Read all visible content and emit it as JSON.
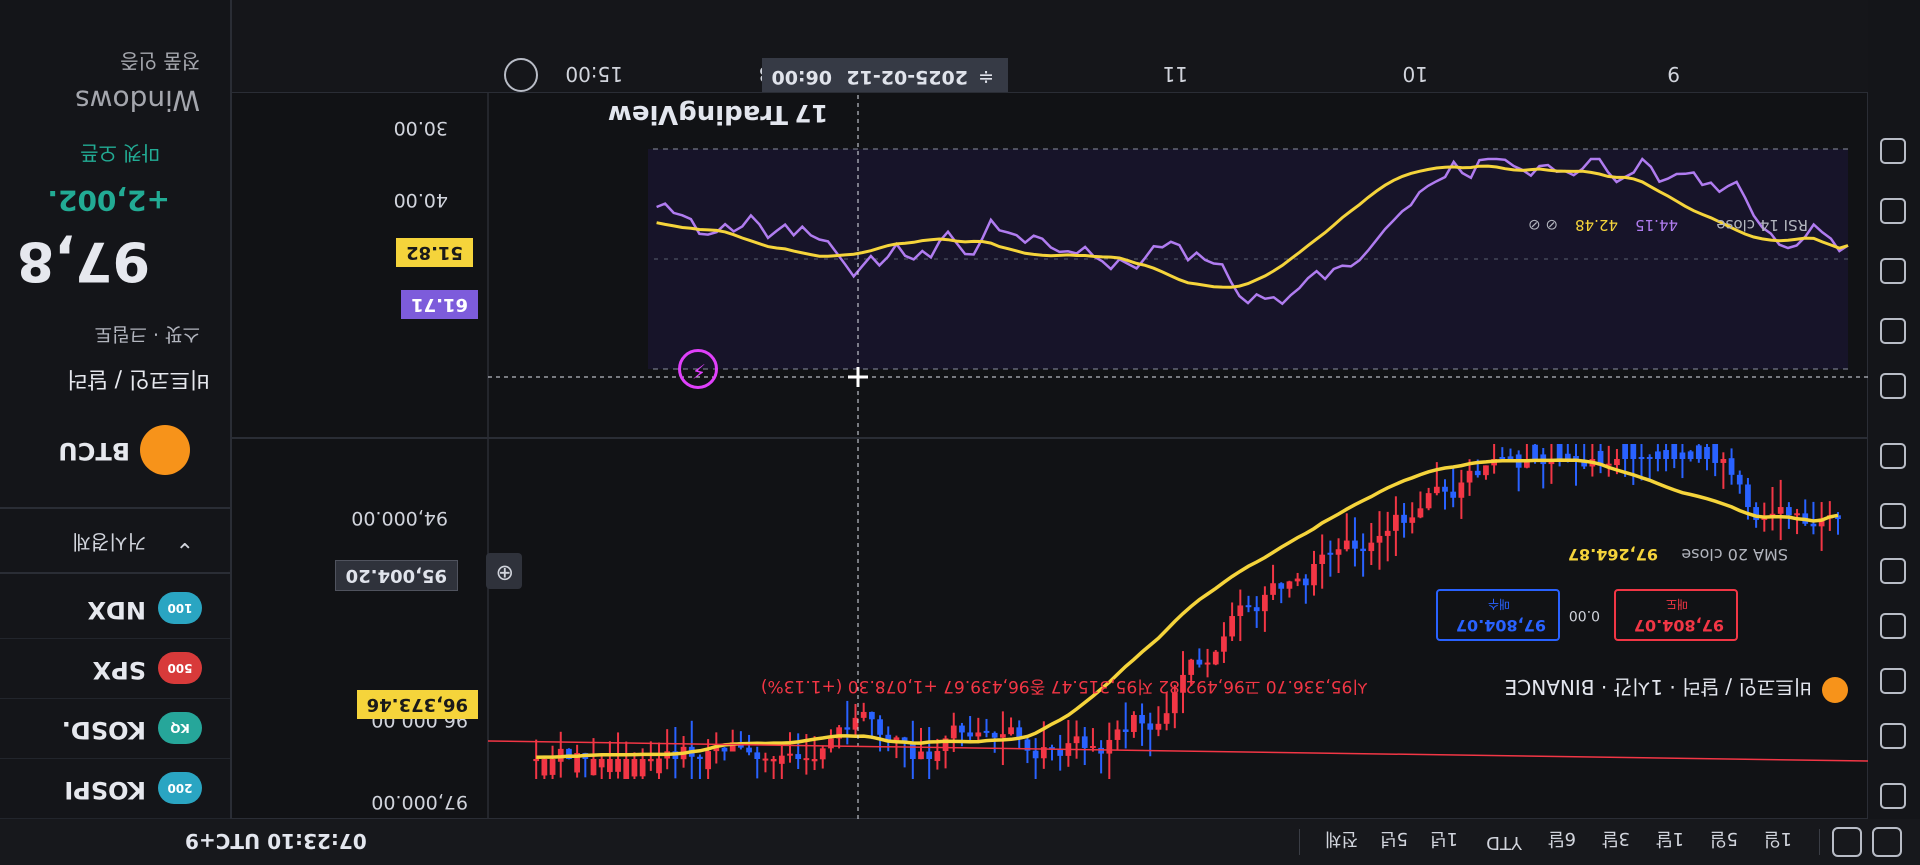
{
  "symbol_header": {
    "title": "비트코인 / 달러 · 1시간 · BINANCE",
    "ohlc": "시95,336.70 고96,492.82 저95,315.47 종96,439.67 +1,078.30 (+1.13%)",
    "sell_price": "97,804.07",
    "sell_label": "매도",
    "spread": "0.00",
    "buy_price": "97,804.07",
    "buy_label": "매수",
    "sma_label": "SMA 20 close",
    "sma_value": "97,264.87",
    "rsi_label": "RSI 14 close",
    "rsi_value": "44.15",
    "rsi_ma_value": "42.48"
  },
  "price_axis": {
    "ticks": [
      "97,000.00",
      "96,000.00",
      "94,000.00"
    ],
    "sma_tag": "96,373.46",
    "crosshair_price": "95,004.20"
  },
  "rsi_axis": {
    "ticks": [
      "40.00",
      "30.00"
    ],
    "rsi_tag": "61.71",
    "ma_tag": "51.82"
  },
  "time_axis": {
    "labels": [
      "9",
      "10",
      "11",
      "13",
      "15:00"
    ],
    "crosshair_date": "2025-02-12",
    "crosshair_time": "06:00"
  },
  "watermark": "TradingView",
  "timeframes": [
    "1일",
    "5일",
    "1달",
    "3달",
    "6달",
    "YTD",
    "1년",
    "5년",
    "전체"
  ],
  "clock": "07:23:10 UTC+9",
  "right_panel": {
    "os_hint": "Windows",
    "os_hint2": "정품 인증",
    "quote_title": "비트코인 / 달러",
    "quote_sub": "스팟 · 크립토",
    "market_status": "마켓 오픈",
    "price": "97,8",
    "change": "+2,002.",
    "section_title": "거시경제",
    "watchlist": [
      {
        "badge": "100",
        "symbol": "NDX",
        "color": "#2aa5c2"
      },
      {
        "badge": "500",
        "symbol": "SPX",
        "color": "#d83a3a"
      },
      {
        "badge": "KQ",
        "symbol": "KOSD.",
        "color": "#26a69a"
      },
      {
        "badge": "200",
        "symbol": "KOSPI",
        "color": "#2aa5c2"
      }
    ]
  },
  "colors": {
    "up": "#f23645",
    "down": "#2962ff",
    "sma": "#f5d43b",
    "rsi": "#b07cf0"
  },
  "chart_data": {
    "type": "candlestick",
    "series": [
      {
        "name": "SMA 20 close",
        "last": 97264.87
      },
      {
        "name": "RSI 14 close",
        "last": 44.15
      }
    ]
  }
}
